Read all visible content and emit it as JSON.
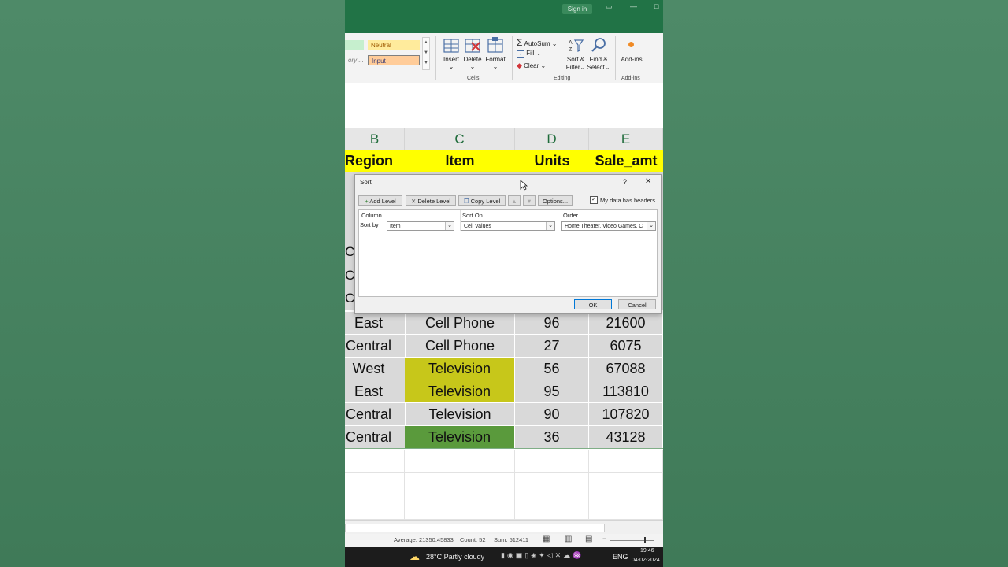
{
  "titlebar": {
    "signin": "Sign in"
  },
  "ribbon": {
    "styles": {
      "neutral": "Neutral",
      "input": "Input",
      "category_partial": "ory ..."
    },
    "cells": {
      "insert": "Insert",
      "delete": "Delete",
      "format": "Format",
      "group": "Cells"
    },
    "editing": {
      "autosum": "AutoSum",
      "fill": "Fill",
      "clear": "Clear",
      "sort_filter_1": "Sort &",
      "sort_filter_2": "Filter",
      "find_select_1": "Find &",
      "find_select_2": "Select",
      "group": "Editing"
    },
    "addins": {
      "label": "Add-ins",
      "group": "Add-ins"
    }
  },
  "columns": [
    "B",
    "C",
    "D",
    "E"
  ],
  "header_row": [
    "Region",
    "Item",
    "Units",
    "Sale_amt"
  ],
  "hidden_partial": [
    "C",
    "C",
    "C"
  ],
  "rows": [
    {
      "region": "East",
      "item": "Cell Phone",
      "units": "96",
      "sale": "21600",
      "item_fill": ""
    },
    {
      "region": "Central",
      "item": "Cell Phone",
      "units": "27",
      "sale": "6075",
      "item_fill": ""
    },
    {
      "region": "West",
      "item": "Television",
      "units": "56",
      "sale": "67088",
      "item_fill": "#c7c71a"
    },
    {
      "region": "East",
      "item": "Television",
      "units": "95",
      "sale": "113810",
      "item_fill": "#c7c71a"
    },
    {
      "region": "Central",
      "item": "Television",
      "units": "90",
      "sale": "107820",
      "item_fill": ""
    },
    {
      "region": "Central",
      "item": "Television",
      "units": "36",
      "sale": "43128",
      "item_fill": "#5a9a3c"
    }
  ],
  "dialog": {
    "title": "Sort",
    "help": "?",
    "close": "✕",
    "add_level": "Add Level",
    "delete_level": "Delete Level",
    "copy_level": "Copy Level",
    "options": "Options...",
    "headers_checkbox": "My data has headers",
    "col_header": "Column",
    "sorton_header": "Sort On",
    "order_header": "Order",
    "sort_by": "Sort by",
    "column_value": "Item",
    "sorton_value": "Cell Values",
    "order_value": "Home Theater, Video Games, C",
    "ok": "OK",
    "cancel": "Cancel"
  },
  "statusbar": {
    "average": "Average: 21350.45833",
    "count": "Count: 52",
    "sum": "Sum: 512411"
  },
  "taskbar": {
    "weather": "28°C  Partly cloudy",
    "lang": "ENG",
    "time": "19:46",
    "date": "04-02-2024"
  },
  "colors": {
    "excel_green": "#217346",
    "header_yellow": "#ffff00",
    "yellow_fill": "#c7c71a",
    "green_fill": "#5a9a3c"
  }
}
